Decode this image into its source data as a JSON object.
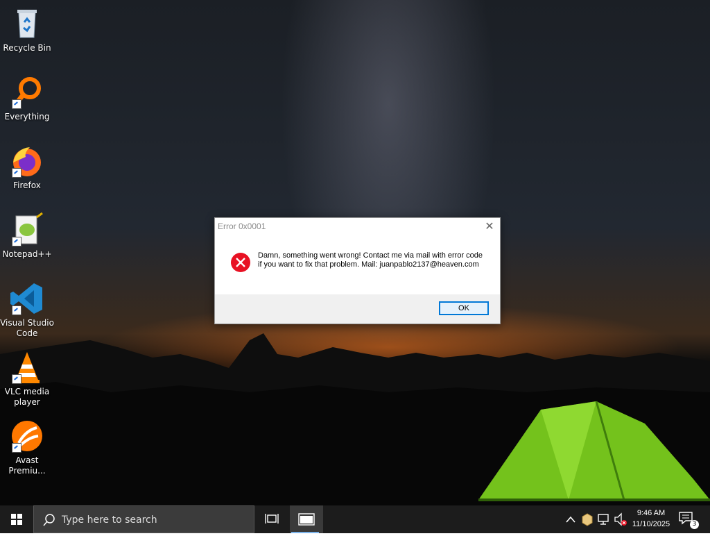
{
  "desktop": {
    "icons": [
      {
        "label": "Recycle Bin",
        "icon": "recycle-bin-icon"
      },
      {
        "label": "Everything",
        "icon": "everything-search-icon"
      },
      {
        "label": "Firefox",
        "icon": "firefox-icon"
      },
      {
        "label": "Notepad++",
        "icon": "notepad-plus-plus-icon"
      },
      {
        "label": "Visual Studio Code",
        "icon": "vscode-icon"
      },
      {
        "label": "VLC media player",
        "icon": "vlc-icon"
      },
      {
        "label": "Avast Premiu...",
        "icon": "avast-icon"
      }
    ]
  },
  "dialog": {
    "title": "Error 0x0001",
    "message": "Damn, something went wrong! Contact me via mail with error code if you want to fix that problem. Mail: juanpablo2137@heaven.com",
    "ok_label": "OK",
    "close_glyph": "✕"
  },
  "taskbar": {
    "search_placeholder": "Type here to search",
    "time": "9:46 AM",
    "date": "11/10/2025",
    "notification_count": "3"
  },
  "colors": {
    "taskbar_bg": "#1c1c1c",
    "accent": "#0078d7",
    "error_red": "#e81123"
  }
}
